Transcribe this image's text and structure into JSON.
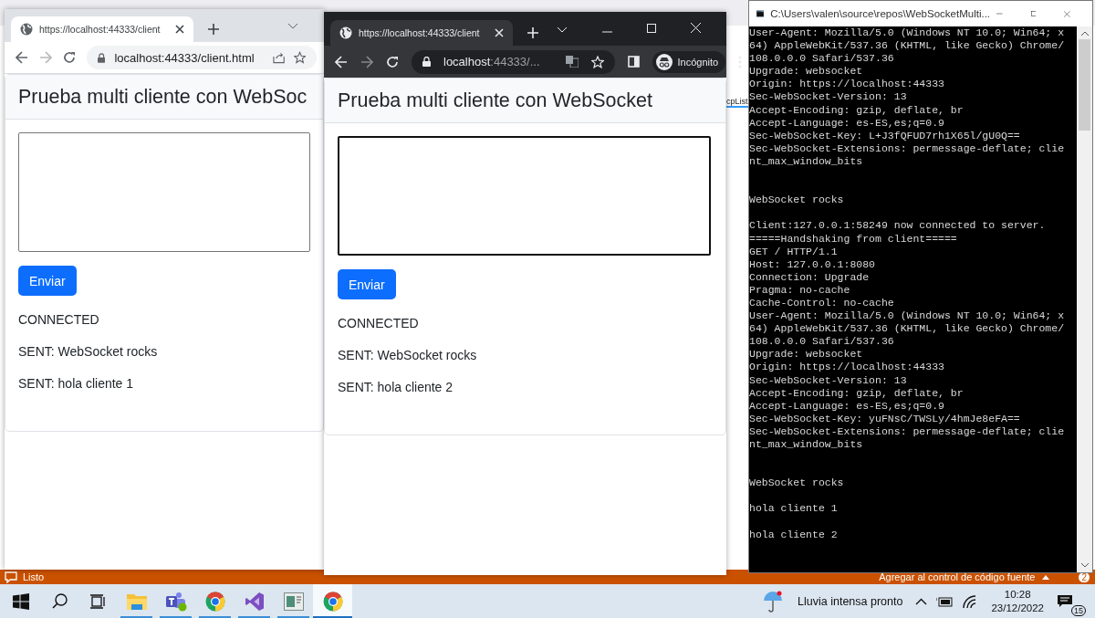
{
  "ide": {
    "tab_fragment": "cpList",
    "status": "Listo",
    "source_control": "Agregar al control de código fuente",
    "pending_changes": "2"
  },
  "browsers": [
    {
      "kind": "normal",
      "tab_title": "https://localhost:44333/client",
      "url_host": "localhost:44333/client.html",
      "heading": "Prueba multi cliente con WebSoc",
      "message_focused": false,
      "button": "Enviar",
      "log": [
        "CONNECTED",
        "SENT: WebSocket rocks",
        "SENT: hola cliente 1"
      ]
    },
    {
      "kind": "incognito",
      "tab_title": "https://localhost:44333/client",
      "url_host": "localhost",
      "url_rest": ":44333/...",
      "profile": "Incógnito",
      "heading": "Prueba multi cliente con WebSocket",
      "message_focused": true,
      "button": "Enviar",
      "log": [
        "CONNECTED",
        "SENT: WebSocket rocks",
        "SENT: hola cliente 2"
      ]
    }
  ],
  "console": {
    "title": "C:\\Users\\valen\\source\\repos\\WebSocketMulti...",
    "blocks": [
      {
        "lines": [
          "User-Agent: Mozilla/5.0 (Windows NT 10.0; Win64; x",
          "64) AppleWebKit/537.36 (KHTML, like Gecko) Chrome/",
          "108.0.0.0 Safari/537.36",
          "Upgrade: websocket",
          "Origin: https://localhost:44333",
          "Sec-WebSocket-Version: 13",
          "Accept-Encoding: gzip, deflate, br",
          "Accept-Language: es-ES,es;q=0.9",
          "Sec-WebSocket-Key: L+J3fQFUD7rh1X65l/gU0Q==",
          "Sec-WebSocket-Extensions: permessage-deflate; clie",
          "nt_max_window_bits"
        ]
      },
      {
        "lines": [
          "WebSocket rocks"
        ]
      },
      {
        "lines": [
          "Client:127.0.0.1:58249 now connected to server.",
          "=====Handshaking from client=====",
          "GET / HTTP/1.1",
          "Host: 127.0.0.1:8080",
          "Connection: Upgrade",
          "Pragma: no-cache",
          "Cache-Control: no-cache",
          "User-Agent: Mozilla/5.0 (Windows NT 10.0; Win64; x",
          "64) AppleWebKit/537.36 (KHTML, like Gecko) Chrome/",
          "108.0.0.0 Safari/537.36",
          "Upgrade: websocket",
          "Origin: https://localhost:44333",
          "Sec-WebSocket-Version: 13",
          "Accept-Encoding: gzip, deflate, br",
          "Accept-Language: es-ES,es;q=0.9",
          "Sec-WebSocket-Key: yuFNsC/TWSLy/4hmJe8eFA==",
          "Sec-WebSocket-Extensions: permessage-deflate; clie",
          "nt_max_window_bits"
        ]
      },
      {
        "lines": [
          "WebSocket rocks"
        ]
      },
      {
        "lines": [
          "hola cliente 1"
        ]
      },
      {
        "lines": [
          "hola cliente 2"
        ]
      }
    ]
  },
  "taskbar": {
    "buttons": [
      {
        "kind": "start"
      },
      {
        "kind": "search"
      },
      {
        "kind": "taskview"
      }
    ],
    "apps": [
      {
        "kind": "explorer",
        "running": true,
        "selected": false
      },
      {
        "kind": "teams",
        "running": true,
        "selected": false
      },
      {
        "kind": "chrome",
        "running": true,
        "selected": false
      },
      {
        "kind": "vs",
        "running": true,
        "selected": false
      },
      {
        "kind": "app",
        "running": true,
        "selected": false
      },
      {
        "kind": "chrome",
        "running": true,
        "selected": true
      }
    ],
    "weather": "Lluvia intensa pronto",
    "time": "10:28",
    "date": "23/12/2022",
    "notifications": "15"
  }
}
